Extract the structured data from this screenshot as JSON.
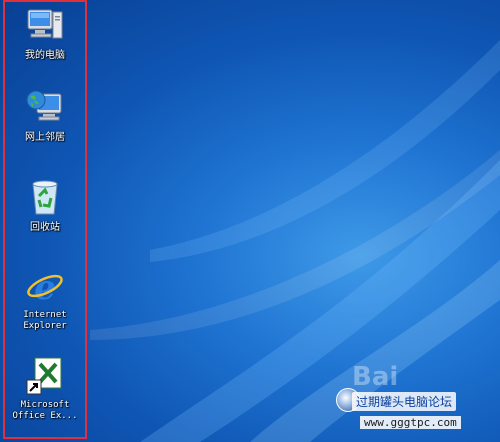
{
  "desktop": {
    "icons": [
      {
        "id": "my-computer",
        "label": "我的电脑",
        "icon": "my-computer-icon"
      },
      {
        "id": "network-places",
        "label": "网上邻居",
        "icon": "network-places-icon"
      },
      {
        "id": "recycle-bin",
        "label": "回收站",
        "icon": "recycle-bin-icon"
      },
      {
        "id": "internet-explorer",
        "label": "Internet\nExplorer",
        "icon": "internet-explorer-icon"
      },
      {
        "id": "office-excel",
        "label": "Microsoft\nOffice Ex...",
        "icon": "excel-shortcut-icon"
      }
    ]
  },
  "watermark": {
    "title": "过期罐头电脑论坛",
    "url": "www.gggtpc.com",
    "logo": "badge-logo",
    "faint_text": "Bai"
  },
  "colors": {
    "selection_border": "#e0303a",
    "desktop_bg": "#1f74d2"
  }
}
